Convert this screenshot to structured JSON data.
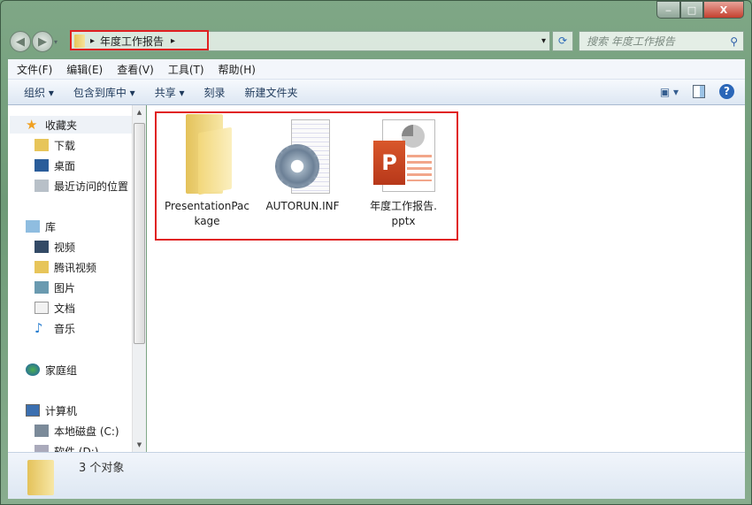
{
  "window": {
    "minimize": "‒",
    "maximize": "□",
    "close": "X"
  },
  "address": {
    "crumb": "年度工作报告",
    "arrow1": "▸",
    "arrow2": "▸",
    "dropdown": "▾",
    "refresh": "⟳"
  },
  "search": {
    "placeholder": "搜索 年度工作报告",
    "icon": "⚲"
  },
  "menu": [
    "文件(F)",
    "编辑(E)",
    "查看(V)",
    "工具(T)",
    "帮助(H)"
  ],
  "toolbar": {
    "organize": "组织 ▾",
    "include": "包含到库中 ▾",
    "share": "共享 ▾",
    "burn": "刻录",
    "new_folder": "新建文件夹",
    "help": "?"
  },
  "nav": {
    "favorites": "收藏夹",
    "downloads": "下载",
    "desktop": "桌面",
    "recent": "最近访问的位置",
    "libraries": "库",
    "videos": "视频",
    "tencent": "腾讯视频",
    "pictures": "图片",
    "documents": "文档",
    "music": "音乐",
    "homegroup": "家庭组",
    "computer": "计算机",
    "c_drive": "本地磁盘 (C:)",
    "d_drive": "软件 (D:)"
  },
  "files": [
    {
      "name": "PresentationPac\nkage",
      "l1": "PresentationPac",
      "l2": "kage"
    },
    {
      "l1": "AUTORUN.INF"
    },
    {
      "l1": "年度工作报告.",
      "l2": "pptx"
    }
  ],
  "status": {
    "count": "3 个对象"
  }
}
